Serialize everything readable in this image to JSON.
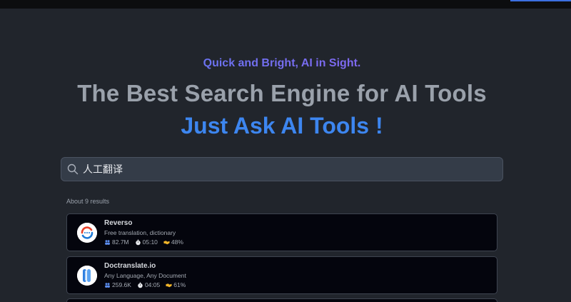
{
  "hero": {
    "tagline": "Quick and Bright, AI in Sight.",
    "headline": "The Best Search Engine for AI Tools",
    "headline_highlight": "Just Ask AI Tools !"
  },
  "search": {
    "query": "人工翻译",
    "icon": "search-icon"
  },
  "results": {
    "count_text": "About 9 results",
    "items": [
      {
        "name": "Reverso",
        "description": "Free translation, dictionary",
        "visits": "82.7M",
        "time": "05:10",
        "rate": "48%",
        "logo": "reverso-logo"
      },
      {
        "name": "Doctranslate.io",
        "description": "Any Language, Any Document",
        "visits": "259.6K",
        "time": "04:05",
        "rate": "61%",
        "logo": "doctranslate-logo"
      }
    ]
  },
  "colors": {
    "background": "#21252c",
    "accent_blue": "#3d86f0",
    "tagline_gradient_start": "#4f7ff0",
    "tagline_gradient_end": "#9b5cf0",
    "card_bg": "#04050d",
    "stat_icon_users": "#5b8def",
    "stat_icon_rate": "#f0b429"
  }
}
